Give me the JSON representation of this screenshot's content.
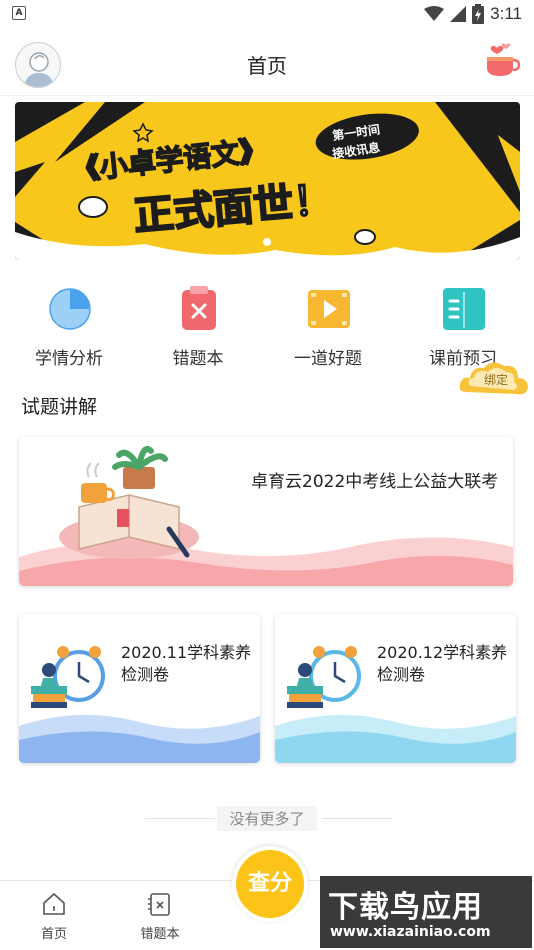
{
  "status_bar": {
    "time": "3:11",
    "left_indicator": "A"
  },
  "header": {
    "title": "首页"
  },
  "banner": {
    "brand": "《小卓学语文》",
    "slogan": "正式面世！",
    "tag": "第一时间接收讯息",
    "accent": "#f7c81b"
  },
  "tiles": [
    {
      "label": "学情分析",
      "icon": "pie-chart-icon",
      "color": "#5aa9f0"
    },
    {
      "label": "错题本",
      "icon": "clipboard-x-icon",
      "color": "#f0676e"
    },
    {
      "label": "一道好题",
      "icon": "video-icon",
      "color": "#f7b731"
    },
    {
      "label": "课前预习",
      "icon": "book-icon",
      "color": "#2ec4c4"
    }
  ],
  "bind_badge": "绑定",
  "section": {
    "title": "试题讲解"
  },
  "cards": [
    {
      "title": "卓育云2022中考线上公益大联考"
    },
    {
      "title": "2020.11学科素养检测卷"
    },
    {
      "title": "2020.12学科素养检测卷"
    }
  ],
  "no_more": "没有更多了",
  "bottom_nav": {
    "home": "首页",
    "wrongbook": "错题本",
    "check": "查分"
  },
  "watermark": {
    "line1": "下载鸟应用",
    "line2": "www.xiazainiao.com"
  }
}
